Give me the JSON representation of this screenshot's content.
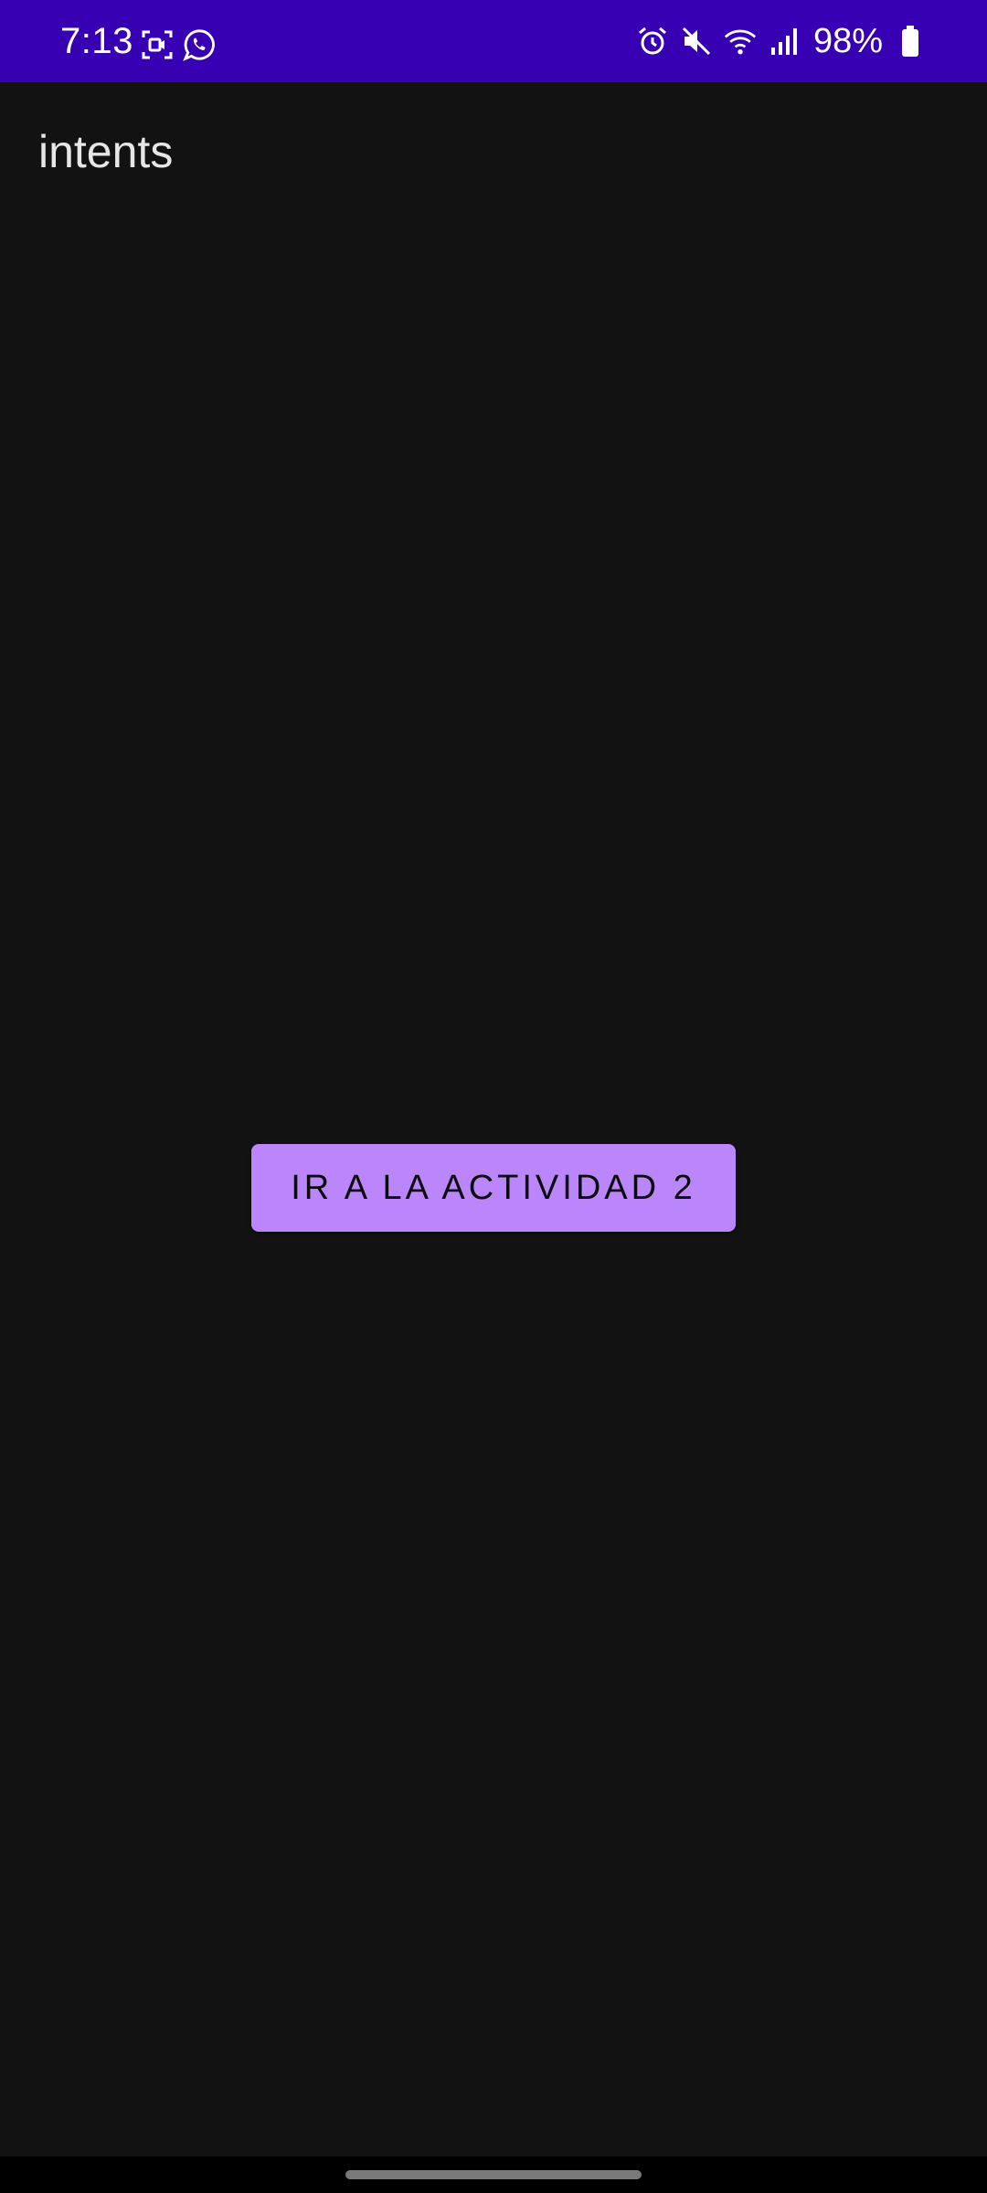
{
  "status_bar": {
    "time": "7:13",
    "battery_percent": "98%",
    "background_color": "#3700b3",
    "left_icons": [
      "screen-record-icon",
      "whatsapp-icon"
    ],
    "right_icons": [
      "alarm-icon",
      "mute-icon",
      "wifi-icon",
      "signal-icon",
      "battery-icon"
    ]
  },
  "app_bar": {
    "title": "intents"
  },
  "main": {
    "button_label": "IR A LA ACTIVIDAD 2",
    "button_color": "#bb86fc"
  },
  "theme": {
    "background": "#121212"
  }
}
